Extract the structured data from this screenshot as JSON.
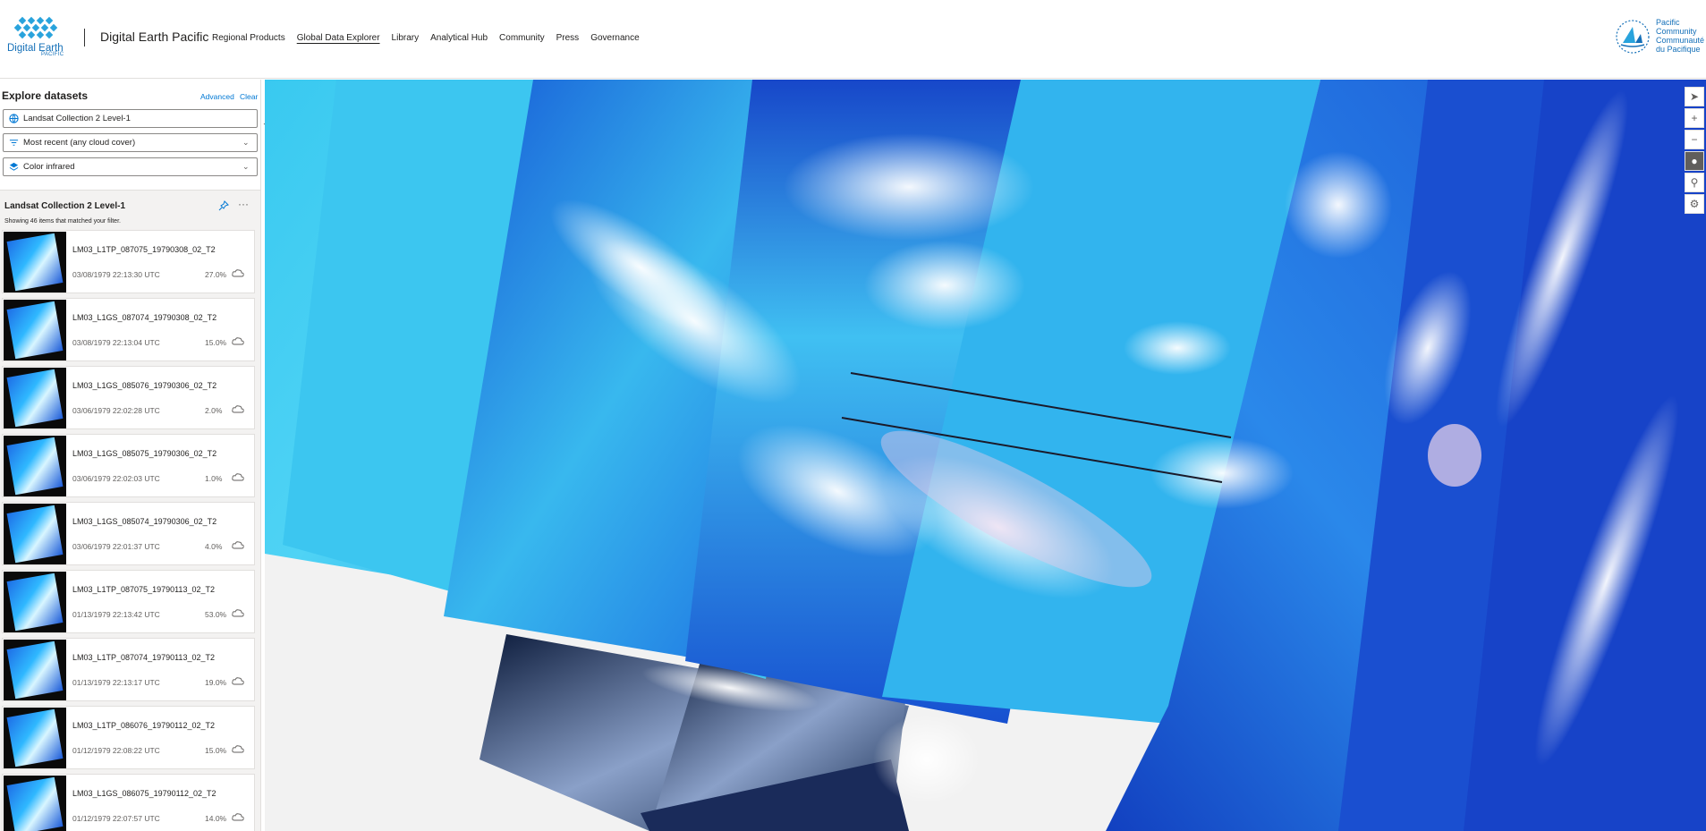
{
  "header": {
    "logo_text": "Digital Earth",
    "logo_sub": "PACIFIC",
    "site_title": "Digital Earth Pacific",
    "nav": [
      {
        "label": "Regional Products",
        "active": false
      },
      {
        "label": "Global Data Explorer",
        "active": true
      },
      {
        "label": "Library",
        "active": false
      },
      {
        "label": "Analytical Hub",
        "active": false
      },
      {
        "label": "Community",
        "active": false
      },
      {
        "label": "Press",
        "active": false
      },
      {
        "label": "Governance",
        "active": false
      }
    ],
    "partner_lines": [
      "Pacific",
      "Community",
      "Communauté",
      "du Pacifique"
    ]
  },
  "sidebar": {
    "title": "Explore datasets",
    "advanced": "Advanced",
    "clear": "Clear",
    "dataset": "Landsat Collection 2 Level-1",
    "filter": "Most recent (any cloud cover)",
    "render": "Color infrared",
    "list_title": "Landsat Collection 2 Level-1",
    "list_subtitle": "Showing 46 items that matched your filter.",
    "items": [
      {
        "title": "LM03_L1TP_087075_19790308_02_T2",
        "date": "03/08/1979 22:13:30 UTC",
        "cloud": "27.0%"
      },
      {
        "title": "LM03_L1GS_087074_19790308_02_T2",
        "date": "03/08/1979 22:13:04 UTC",
        "cloud": "15.0%"
      },
      {
        "title": "LM03_L1GS_085076_19790306_02_T2",
        "date": "03/06/1979 22:02:28 UTC",
        "cloud": "2.0%"
      },
      {
        "title": "LM03_L1GS_085075_19790306_02_T2",
        "date": "03/06/1979 22:02:03 UTC",
        "cloud": "1.0%"
      },
      {
        "title": "LM03_L1GS_085074_19790306_02_T2",
        "date": "03/06/1979 22:01:37 UTC",
        "cloud": "4.0%"
      },
      {
        "title": "LM03_L1TP_087075_19790113_02_T2",
        "date": "01/13/1979 22:13:42 UTC",
        "cloud": "53.0%"
      },
      {
        "title": "LM03_L1TP_087074_19790113_02_T2",
        "date": "01/13/1979 22:13:17 UTC",
        "cloud": "19.0%"
      },
      {
        "title": "LM03_L1TP_086076_19790112_02_T2",
        "date": "01/12/1979 22:08:22 UTC",
        "cloud": "15.0%"
      },
      {
        "title": "LM03_L1GS_086075_19790112_02_T2",
        "date": "01/12/1979 22:07:57 UTC",
        "cloud": "14.0%"
      }
    ]
  },
  "map": {
    "controls": [
      "compass-icon",
      "zoom-in-icon",
      "zoom-out-icon",
      "layers-icon",
      "search-icon",
      "settings-icon"
    ]
  }
}
